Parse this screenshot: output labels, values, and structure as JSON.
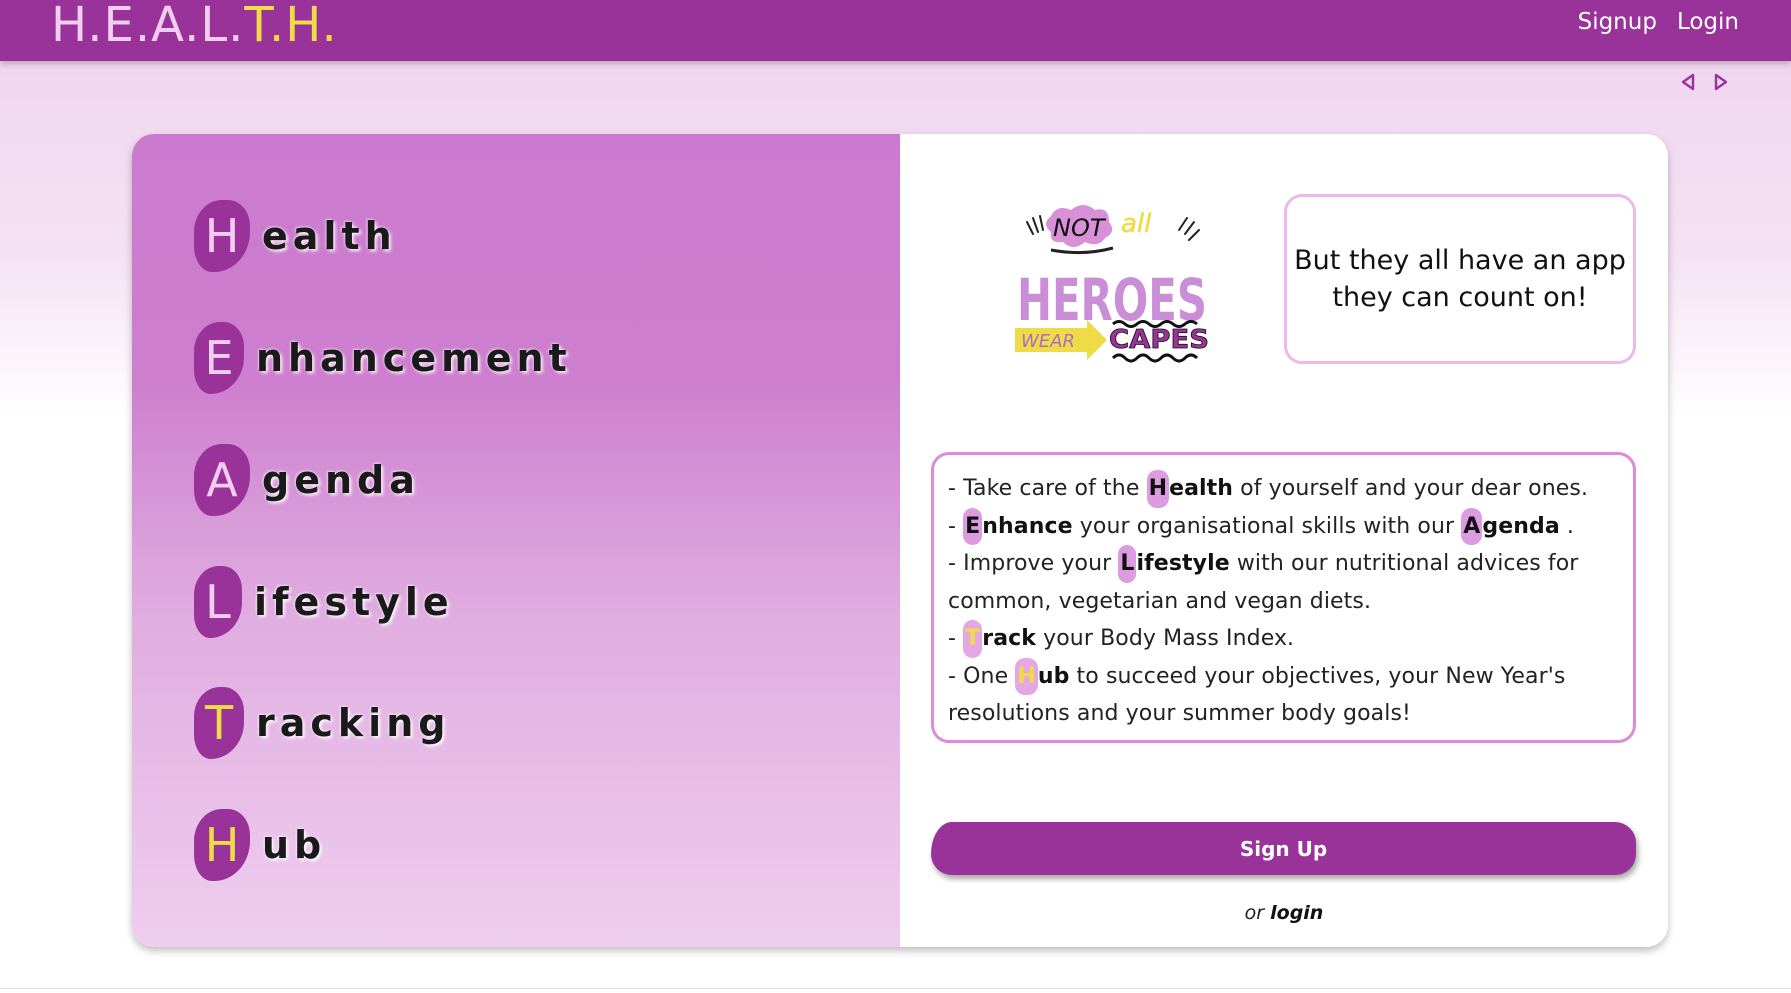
{
  "navbar": {
    "brand_part1": "H.E.A.L.",
    "brand_part2": "T.H.",
    "signup_label": "Signup",
    "login_label": "Login"
  },
  "colors": {
    "primary": "#993399",
    "accent_yellow": "#eedc47",
    "light_pink": "#f1cdf0",
    "panel_purple": "#cb7bcf"
  },
  "acronym": [
    {
      "letter": "H",
      "rest": "ealth"
    },
    {
      "letter": "E",
      "rest": "nhancement"
    },
    {
      "letter": "A",
      "rest": "genda"
    },
    {
      "letter": "L",
      "rest": "ifestyle"
    },
    {
      "letter": "T",
      "rest": "racking"
    },
    {
      "letter": "H",
      "rest": "ub"
    }
  ],
  "hero_image": {
    "not": "NOT",
    "all": "all",
    "heroes": "HEROES",
    "wear": "WEAR",
    "capes": "CAPES"
  },
  "slogan": "But they all have an app they can count on!",
  "features": {
    "l1_a": "- Take care of the ",
    "l1_f": "H",
    "l1_b": "ealth",
    "l1_c": " of yourself and your dear ones.",
    "l2_a": "- ",
    "l2_f": "E",
    "l2_b": "nhance",
    "l2_c": " your organisational skills with our ",
    "l2_f2": "A",
    "l2_b2": "genda",
    "l2_d": " .",
    "l3_a": "- Improve your ",
    "l3_f": "L",
    "l3_b": "ifestyle",
    "l3_c": " with our nutritional advices for common, vegetarian and vegan diets.",
    "l4_a": "- ",
    "l4_f": "T",
    "l4_b": "rack",
    "l4_c": " your Body Mass Index.",
    "l5_a": "- One ",
    "l5_f": "H",
    "l5_b": "ub",
    "l5_c": " to succeed your objectives, your New Year's resolutions and your summer body goals!"
  },
  "signup_button": "Sign Up",
  "or_text": "or",
  "login_link": "login"
}
